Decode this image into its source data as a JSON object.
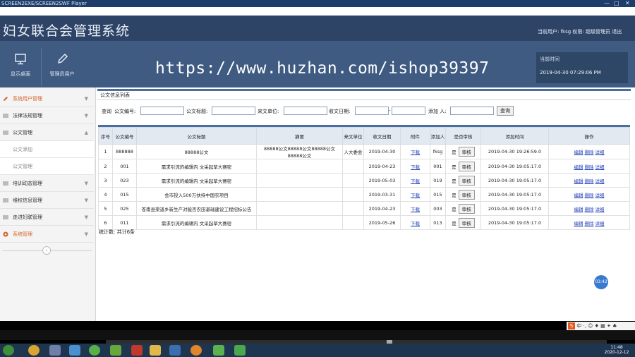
{
  "window": {
    "title": "SCREEN2EXE/SCREEN2SWF Player",
    "controls": [
      "—",
      "□",
      "✕"
    ]
  },
  "app": {
    "title": "妇女联合会管理系统",
    "user_info": "当前用户: fksg 权限: 超级管理员 退出",
    "nav": [
      {
        "label": "显示桌面",
        "icon": "monitor-icon"
      },
      {
        "label": "管理员用户",
        "icon": "pencil-icon"
      }
    ],
    "watermark": "https://www.huzhan.com/ishop39397",
    "time_box": {
      "label": "当前时间",
      "value": "2019-04-30 07:29:06 PM"
    }
  },
  "sidebar": {
    "items": [
      {
        "label": "系统用户管理",
        "active": true,
        "icon": "pencil-icon",
        "arrow": "▼"
      },
      {
        "label": "法律法规管理",
        "icon": "grid-icon",
        "arrow": "▼"
      },
      {
        "label": "公文管理",
        "icon": "grid-icon",
        "arrow": "▲"
      },
      {
        "label": "公文添加",
        "sub": true
      },
      {
        "label": "公文管理",
        "sub": true
      },
      {
        "label": "培训动态管理",
        "icon": "grid-icon",
        "arrow": "▼"
      },
      {
        "label": "维权信息管理",
        "icon": "grid-icon",
        "arrow": "▼"
      },
      {
        "label": "走进妇联管理",
        "icon": "grid-icon",
        "arrow": "▼"
      },
      {
        "label": "系统管理",
        "active": true,
        "icon": "gear-icon",
        "arrow": "▼"
      }
    ],
    "collapse": "‹"
  },
  "panel": {
    "title": "公文信息列表"
  },
  "search": {
    "prefix": "查询",
    "fields": [
      "公文编号:",
      "公文标题:",
      "来文单位:",
      "收文日期:",
      "",
      "添加 人:"
    ],
    "date_sep": "-",
    "button": "查询"
  },
  "table": {
    "headers": [
      "序号",
      "公文编号",
      "公文标题",
      "摘要",
      "来文单位",
      "收文日期",
      "附件",
      "添加人",
      "是否审核",
      "添加时间",
      "操作"
    ],
    "rows": [
      {
        "no": "1",
        "code": "888888",
        "title": "88888公文",
        "summary": "88888公文88888公文88888公文88888公文",
        "unit": "人大委会",
        "date": "2019-04-30",
        "attach": "下载",
        "user": "fksg",
        "audit": "是",
        "audit_btn": "审核",
        "time": "2019-04-30 19:26:59.0"
      },
      {
        "no": "2",
        "code": "001",
        "title": "需求引流的编辑内 文采起草大赛密",
        "summary": "",
        "unit": "",
        "date": "2019-04-23",
        "attach": "下载",
        "user": "001",
        "audit": "是",
        "audit_btn": "审核",
        "time": "2019-04-30 19:05:17.0"
      },
      {
        "no": "3",
        "code": "023",
        "title": "需求引流的编辑内 文采起草大赛密",
        "summary": "",
        "unit": "",
        "date": "2019-05-03",
        "attach": "下载",
        "user": "019",
        "audit": "是",
        "audit_btn": "审核",
        "time": "2019-04-30 19:05:17.0"
      },
      {
        "no": "4",
        "code": "015",
        "title": "会市投入500万扶持中国农项目",
        "summary": "",
        "unit": "",
        "date": "2019-03-31",
        "attach": "下载",
        "user": "015",
        "audit": "是",
        "audit_btn": "审核",
        "time": "2019-04-30 19:05:17.0"
      },
      {
        "no": "5",
        "code": "025",
        "title": "苍南县渠道乡新生产对能否农田基础建设工程招标公告",
        "summary": "",
        "unit": "",
        "date": "2019-04-23",
        "attach": "下载",
        "user": "003",
        "audit": "是",
        "audit_btn": "审核",
        "time": "2019-04-30 19:05:17.0"
      },
      {
        "no": "6",
        "code": "011",
        "title": "需求引流的编辑内 文采起草大赛密",
        "summary": "",
        "unit": "",
        "date": "2019-05-26",
        "attach": "下载",
        "user": "013",
        "audit": "是",
        "audit_btn": "审核",
        "time": "2019-04-30 19:05:17.0"
      }
    ],
    "actions": [
      "编辑",
      "删除",
      "详细"
    ]
  },
  "stat": "统计数: 共计6条",
  "float_badge": "03:42",
  "ime": {
    "s": "S",
    "text": "中 ·, ☺ ♦ ▦ ✦ ♣"
  },
  "clock": {
    "time": "11:48",
    "date": "2020-12-12"
  },
  "colors": {
    "topbar": "#2d4467",
    "nav": "#3f5b82",
    "accent": "#d9622b",
    "header_line": "#4a6ea1",
    "link": "#1f3fb8"
  }
}
